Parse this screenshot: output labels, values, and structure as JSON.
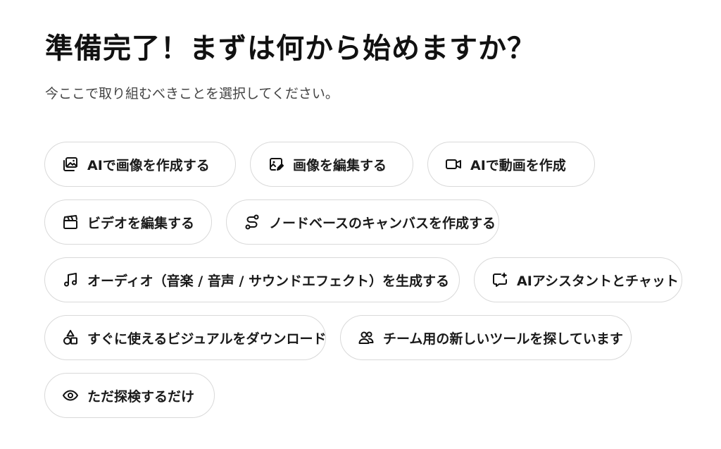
{
  "page": {
    "title": "準備完了！まずは何から始めますか？",
    "subtitle": "今ここで取り組むべきことを選択してください。"
  },
  "options": [
    {
      "icon": "image-ai-icon",
      "label": "AIで画像を作成する"
    },
    {
      "icon": "image-edit-icon",
      "label": "画像を編集する"
    },
    {
      "icon": "video-camera-icon",
      "label": "AIで動画を作成"
    },
    {
      "icon": "clapperboard-icon",
      "label": "ビデオを編集する"
    },
    {
      "icon": "node-path-icon",
      "label": "ノードベースのキャンバスを作成する"
    },
    {
      "icon": "music-note-icon",
      "label": "オーディオ（音楽 / 音声 / サウンドエフェクト）を生成する"
    },
    {
      "icon": "chat-sparkle-icon",
      "label": "AIアシスタントとチャット"
    },
    {
      "icon": "shapes-icon",
      "label": "すぐに使えるビジュアルをダウンロード"
    },
    {
      "icon": "users-icon",
      "label": "チーム用の新しいツールを探しています"
    },
    {
      "icon": "eye-icon",
      "label": "ただ探検するだけ"
    }
  ],
  "colors": {
    "border": "#d9d9d9",
    "text": "#111111",
    "subtext": "#444444"
  }
}
